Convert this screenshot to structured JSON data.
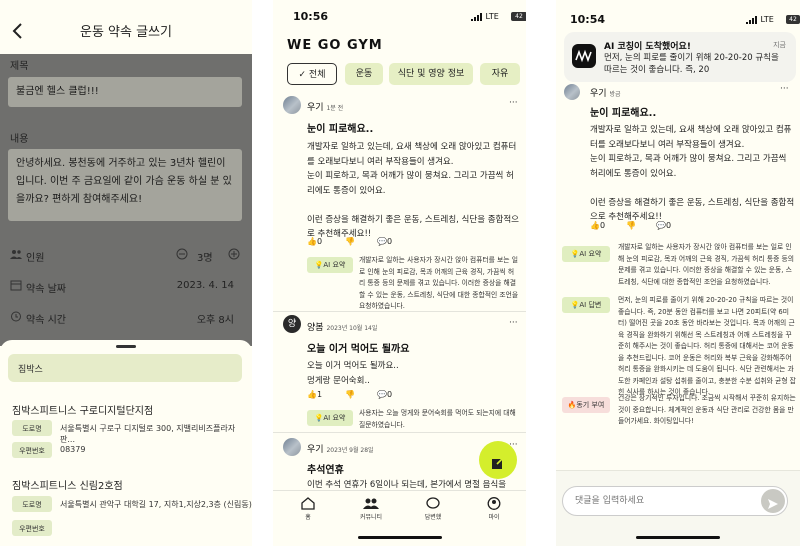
{
  "phone1": {
    "title": "운동 약속 글쓰기",
    "title_label": "제목",
    "title_value": "불금엔 헬스 클럽!!!",
    "content_label": "내용",
    "content_value": "안녕하세요. 봉천동에 거주하고 있는 3년차 헬린이입니다. 이번 주 금요일에 같이 가슴 운동 하실 분 있을까요? 편하게 참여해주세요!",
    "people_label": "인원",
    "people_value": "3명",
    "date_label": "약속 날짜",
    "date_value": "2023. 4. 14",
    "time_label": "약속 시간",
    "time_value": "오후 8시",
    "search_value": "짐박스",
    "results": [
      {
        "name": "짐박스피트니스 구로디지털단지점",
        "addr_tag": "도로명",
        "addr": "서울특별시 구로구 디지털로 300, 지밸리비즈플라자 판...",
        "zip_tag": "우편번호",
        "zip": "08379"
      },
      {
        "name": "짐박스피트니스 신림2호점",
        "addr_tag": "도로명",
        "addr": "서울특별시 관악구 대학길 17, 지하1,지상2,3층 (신림동)",
        "zip_tag": "우편번호",
        "zip": ""
      }
    ]
  },
  "phone2": {
    "time": "10:56",
    "network": "LTE",
    "battery": "42",
    "app_name": "WE GO GYM",
    "chips": [
      "전체",
      "운동",
      "식단 및 영양 정보",
      "자유"
    ],
    "posts": [
      {
        "user": "우기",
        "time": "1분 전",
        "title": "눈이 피로해요..",
        "body": "개발자로 일하고 있는데, 요새 책상에 오래 앉아있고 컴퓨터를 오래보다보니 여러 부작용들이 생겨요.\n눈이 피로하고, 목과 어깨가 많이 뭉쳐요. 그리고 가끔씩 허리에도 통증이 있어요.\n\n이런 증상을 해결하기 좋은 운동, 스트레칭, 식단을 종합적으로 추천해주세요!!",
        "likes": "0",
        "dislikes": "",
        "comments": "0",
        "ai_label": "AI 요약",
        "ai_text": "개발자로 일하는 사용자가 장시간 앉아 컴퓨터를 보는 일로 인해 눈의 피로감, 목과 어깨의 근육 경직, 가끔씩 허리 통증 등의 문제를 겪고 있습니다. 이러한 증상을 해결할 수 있는 운동, 스트레칭, 식단에 대한 종합적인 조언을 요청하였습니다."
      },
      {
        "user": "양봄",
        "avatar_letter": "양",
        "time": "2023년 10월 14일",
        "title": "오늘 이거 먹어도 될까요",
        "body": "오늘 이거 먹어도 될까요..\n멍게랑 문어숙회..",
        "likes": "1",
        "dislikes": "",
        "comments": "0",
        "ai_label": "AI 요약",
        "ai_text": "사용자는 오늘 멍게와 문어숙회를 먹어도 되는지에 대해 질문하였습니다."
      },
      {
        "user": "우기",
        "time": "2023년 9월 28일",
        "title": "추석연휴",
        "body": "이번 추석 연휴가 6일이나 되는데, 본가에서 명절 음식을"
      }
    ],
    "nav": [
      "홈",
      "커뮤니티",
      "답변했",
      "마이"
    ]
  },
  "phone3": {
    "time": "10:54",
    "network": "LTE",
    "battery": "42",
    "notif_title": "AI 코칭이 도착했어요!",
    "notif_body": "먼저, 눈의 피로를 줄이기 위해 20-20-20 규칙을 따르는 것이 좋습니다. 즉, 20",
    "notif_time": "지금",
    "post_user": "우기",
    "post_time": "방금",
    "post_title": "눈이 피로해요..",
    "post_body": "개발자로 일하고 있는데, 요새 책상에 오래 앉아있고 컴퓨터를 오래보다보니 여러 부작용들이 생겨요.\n눈이 피로하고, 목과 어깨가 많이 뭉쳐요. 그리고 가끔씩 허리에도 통증이 있어요.\n\n이런 증상을 해결하기 좋은 운동, 스트레칭, 식단을 종합적으로 추천해주세요!!",
    "likes": "0",
    "comments": "0",
    "ai_summary_label": "AI 요약",
    "ai_summary": "개발자로 일하는 사용자가 장시간 앉아 컴퓨터를 보는 일로 인해 눈의 피로감, 목과 어깨의 근육 경직, 가끔씩 허리 통증 등의 문제를 겪고 있습니다. 이러한 증상을 해결할 수 있는 운동, 스트레칭, 식단에 대한 종합적인 조언을 요청하였습니다.",
    "ai_answer_label": "AI 답변",
    "ai_answer": "먼저, 눈의 피로를 줄이기 위해 20-20-20 규칙을 따르는 것이 좋습니다. 즉, 20분 동안 컴퓨터를 보고 나면 20피트(약 6미터) 떨어진 곳을 20초 동안 바라보는 것입니다. 목과 어깨의 근육 경직을 완화하기 위해선 목 스트레칭과 어깨 스트레칭을 꾸준히 해주시는 것이 좋습니다. 허리 통증에 대해서는 코어 운동을 추천드립니다. 코어 운동은 허리와 복부 근육을 강화해주어 허리 통증을 완화시키는 데 도움이 됩니다. 식단 관련해서는 과도한 카페인과 설탕 섭취를 줄이고, 충분한 수분 섭취와 균형 잡힌 식사를 하시는 것이 좋습니다.",
    "motivation_label": "동기 부여",
    "motivation": "건강은 장기적인 투자입니다. 조금씩 시작해서 꾸준히 유지하는 것이 중요합니다. 체계적인 운동과 식단 관리로 건강한 몸을 만들어가세요. 화이팅입니다!",
    "comment_placeholder": "댓글을 입력하세요"
  }
}
